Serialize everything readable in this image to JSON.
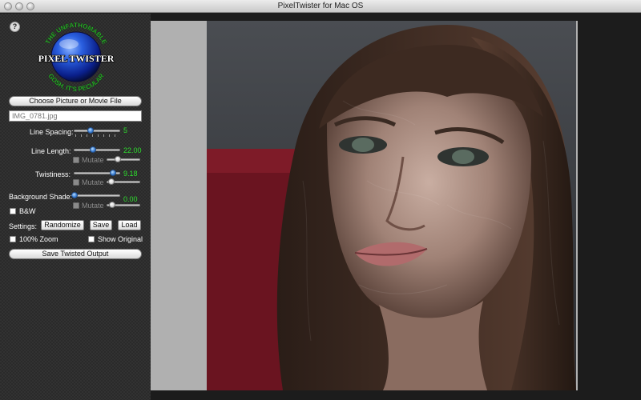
{
  "window": {
    "title": "PixelTwister for Mac OS"
  },
  "logo": {
    "top_text": "THE UNFATHOMABLE",
    "name": "PIXEL TWISTER",
    "bottom_text": "GOSH, IT'S PECULAR"
  },
  "help_label": "?",
  "choose_file_label": "Choose Picture or Movie File",
  "file_name": "IMG_0781.jpg",
  "controls": {
    "line_spacing": {
      "label": "Line Spacing:",
      "value": "5",
      "fraction": 0.38
    },
    "line_length": {
      "label": "Line Length:",
      "value": "22.00",
      "fraction": 0.42,
      "mutate_label": "Mutate",
      "mutate_fraction": 0.4
    },
    "twistiness": {
      "label": "Twistiness:",
      "value": "9.18",
      "fraction": 0.82,
      "mutate_label": "Mutate",
      "mutate_fraction": 0.1
    },
    "background_shade": {
      "label": "Background Shade:",
      "value": "0.00",
      "fraction": 0.0,
      "mutate_label": "Mutate",
      "mutate_fraction": 0.05
    }
  },
  "bw_label": "B&W",
  "settings": {
    "label": "Settings:",
    "randomize": "Randomize",
    "save": "Save",
    "load": "Load"
  },
  "zoom_label": "100% Zoom",
  "show_original_label": "Show Original",
  "save_output_label": "Save Twisted Output",
  "colors": {
    "accent_value": "#2dde2d",
    "panel_bg": "#2a2a2a",
    "canvas_bg": "#b0b0b0",
    "slider_knob": "#3a7fd6"
  }
}
